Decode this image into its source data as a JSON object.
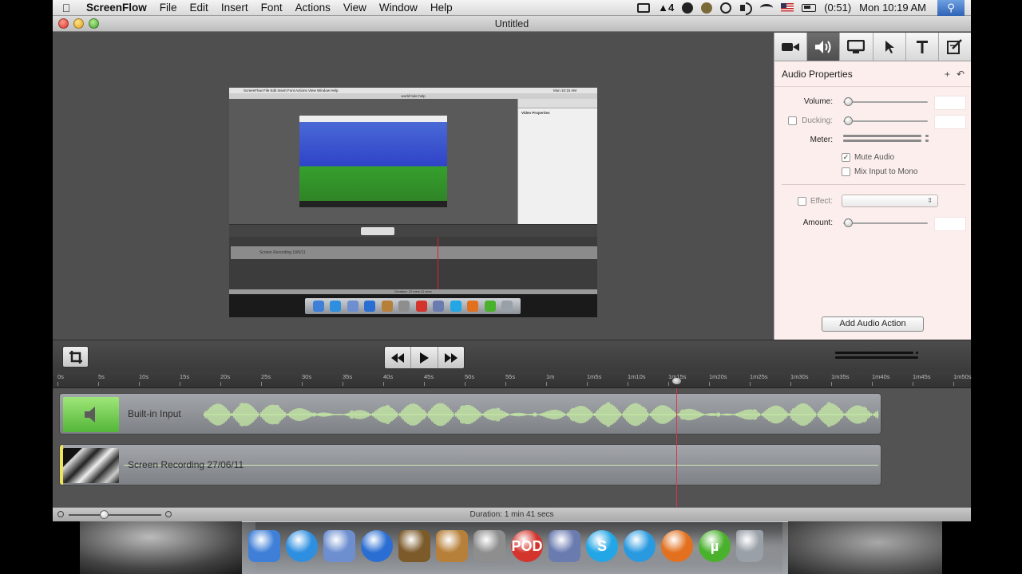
{
  "menubar": {
    "app": "ScreenFlow",
    "items": [
      "File",
      "Edit",
      "Insert",
      "Font",
      "Actions",
      "View",
      "Window",
      "Help"
    ],
    "status_text": "4",
    "battery": "(0:51)",
    "clock": "Mon 10:19 AM"
  },
  "window": {
    "title": "Untitled"
  },
  "preview": {
    "menubar": "ScreenFlow  File  Edit  Insert  Font  Actions  View  Window  Help",
    "clock": "Mon 10:15 AM",
    "title": "world hole help",
    "panel_title": "Video Properties",
    "track_label": "Screen Recording 18/6/11",
    "status": "Duration: 22 mins 41 secs"
  },
  "inspector": {
    "tabs": [
      {
        "icon": "video-camera-icon"
      },
      {
        "icon": "speaker-icon"
      },
      {
        "icon": "monitor-icon"
      },
      {
        "icon": "pointer-icon"
      },
      {
        "icon": "text-icon"
      },
      {
        "icon": "annotation-icon"
      }
    ],
    "title": "Audio Properties",
    "add_symbol": "+",
    "revert_symbol": "↶",
    "volume_label": "Volume:",
    "volume_level": 0.04,
    "ducking_label": "Ducking:",
    "ducking_checked": false,
    "ducking_level": 0.04,
    "meter_label": "Meter:",
    "mute_label": "Mute Audio",
    "mute_checked": true,
    "mix_label": "Mix Input to Mono",
    "mix_checked": false,
    "effect_label": "Effect:",
    "effect_checked": false,
    "effect_arrows": "⇕",
    "amount_label": "Amount:",
    "amount_level": 0.04,
    "add_action": "Add Audio Action"
  },
  "transport": {
    "crop_icon": "crop-icon",
    "rewind_icon": "rewind-icon",
    "play_icon": "play-icon",
    "forward_icon": "fast-forward-icon"
  },
  "ruler": {
    "ticks": [
      "0s",
      "5s",
      "10s",
      "15s",
      "20s",
      "25s",
      "30s",
      "35s",
      "40s",
      "45s",
      "50s",
      "55s",
      "1m",
      "1m5s",
      "1m10s",
      "1m15s",
      "1m20s",
      "1m25s",
      "1m30s",
      "1m35s",
      "1m40s",
      "1m45s",
      "1m50s"
    ]
  },
  "timeline": {
    "audio_clip": "Built-in Input",
    "video_clip": "Screen Recording 27/06/11",
    "playhead_seconds": 76
  },
  "status": {
    "duration": "Duration: 1 min 41 secs"
  },
  "dock": {
    "items": [
      {
        "name": "finder",
        "color": "#3f7fd8"
      },
      {
        "name": "safari",
        "color": "#2e8fe0"
      },
      {
        "name": "preview",
        "color": "#6d8fd0"
      },
      {
        "name": "itunes",
        "color": "#2a6ed3"
      },
      {
        "name": "imovie",
        "color": "#7c5a2a"
      },
      {
        "name": "garageband",
        "color": "#b7803a"
      },
      {
        "name": "system-preferences",
        "color": "#8e8e8e"
      },
      {
        "name": "podcast-capture",
        "color": "#d3342b",
        "text": "POD"
      },
      {
        "name": "iphoto",
        "color": "#6a7bb0"
      },
      {
        "name": "skype",
        "color": "#22a6e6",
        "text": "S"
      },
      {
        "name": "screenflow",
        "color": "#2a9ae0"
      },
      {
        "name": "firefox",
        "color": "#e2701e"
      },
      {
        "name": "utorrent",
        "color": "#4ab12d",
        "text": "µ"
      },
      {
        "name": "trash",
        "color": "#9aa0a8"
      }
    ]
  }
}
